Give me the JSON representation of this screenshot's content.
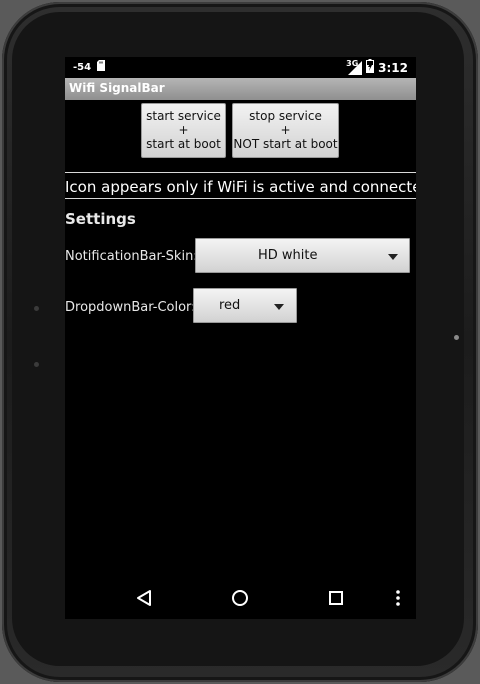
{
  "statusbar": {
    "signal_strength": "-54",
    "network_type": "3G",
    "time": "3:12"
  },
  "app": {
    "title": "Wifi SignalBar"
  },
  "buttons": {
    "start": [
      "start service",
      "+",
      "start at boot"
    ],
    "stop": [
      "stop service",
      "+",
      "NOT start at boot"
    ]
  },
  "info_text": "Icon appears only if WiFi is active and connected.",
  "settings": {
    "heading": "Settings",
    "notification_skin": {
      "label": "NotificationBar-Skin:",
      "value": "HD white"
    },
    "dropdown_color": {
      "label": "DropdownBar-Color:",
      "value": "red"
    }
  },
  "navbar": {
    "icons": [
      "back-icon",
      "home-icon",
      "recents-icon",
      "overflow-menu-icon"
    ]
  },
  "colors": {
    "title_bar": "#a3a3a3",
    "screen_bg": "#000000",
    "bezel": "#1c1c1c"
  }
}
